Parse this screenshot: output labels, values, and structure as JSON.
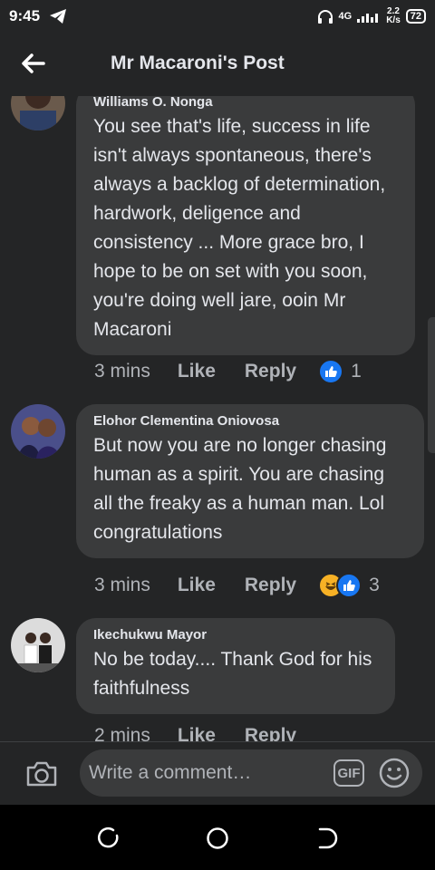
{
  "status_bar": {
    "time": "9:45",
    "network": "4G",
    "speed_value": "2.2",
    "speed_unit": "K/s",
    "battery": "72"
  },
  "header": {
    "title": "Mr Macaroni's Post"
  },
  "comments": [
    {
      "author": "Williams O. Nonga",
      "text": "You see that's life, success in life isn't always spontaneous, there's always a backlog of determination, hardwork, deligence and consistency ... More grace bro, I hope to be on set with you soon, you're doing well jare, ooin Mr Macaroni",
      "time": "3 mins",
      "like": "Like",
      "reply": "Reply",
      "reaction_count": "1"
    },
    {
      "author": "Elohor Clementina Oniovosa",
      "text": "But now you are no longer chasing human as a spirit. You are chasing all the freaky as a human man. Lol congratulations",
      "time": "3 mins",
      "like": "Like",
      "reply": "Reply",
      "reaction_count": "3"
    },
    {
      "author": "Ikechukwu Mayor",
      "text": "No be today.... Thank God for his faithfulness",
      "time": "2 mins",
      "like": "Like",
      "reply": "Reply"
    }
  ],
  "composer": {
    "placeholder": "Write a comment…",
    "gif_label": "GIF"
  },
  "colors": {
    "background": "#242526",
    "bubble": "#3a3b3c",
    "like_blue": "#1877f2",
    "haha_yellow": "#f7b125"
  }
}
